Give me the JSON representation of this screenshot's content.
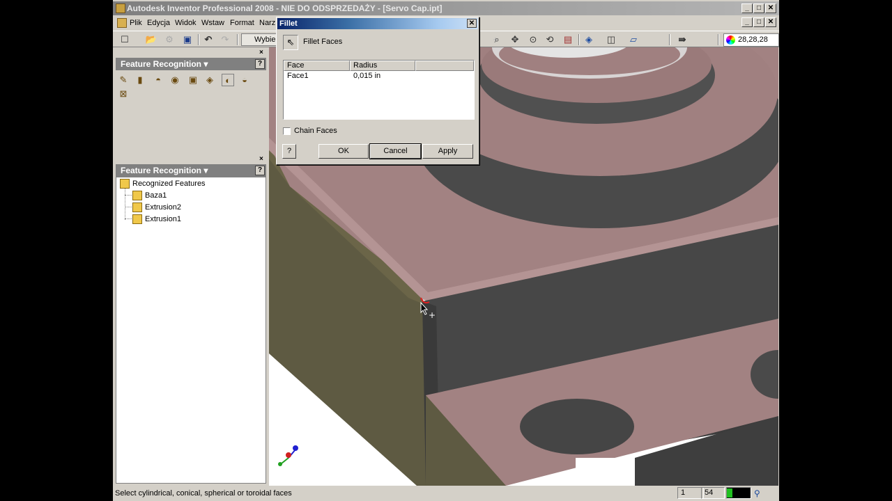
{
  "window": {
    "title": "Autodesk Inventor Professional 2008 - NIE DO ODSPRZEDAŻY - [Servo Cap.ipt]",
    "minimize": "_",
    "maximize": "□",
    "close": "✕"
  },
  "menu": {
    "items": [
      "Plik",
      "Edycja",
      "Widok",
      "Wstaw",
      "Format",
      "Narz"
    ]
  },
  "toolbar": {
    "select_label": "Wybie",
    "color_value": "28,28,28"
  },
  "panel1": {
    "title": "Feature Recognition",
    "help": "?",
    "close": "×"
  },
  "panel2": {
    "title": "Feature Recognition",
    "help": "?",
    "tree": {
      "root": "Recognized Features",
      "children": [
        "Baza1",
        "Extrusion2",
        "Extrusion1"
      ]
    }
  },
  "dialog": {
    "title": "Fillet",
    "close": "✕",
    "mode_label": "Fillet Faces",
    "grid": {
      "headers": [
        "Face",
        "Radius"
      ],
      "rows": [
        {
          "face": "Face1",
          "radius": "0,015 in"
        }
      ]
    },
    "chain_faces_label": "Chain Faces",
    "chain_faces_checked": false,
    "help": "?",
    "ok_label": "OK",
    "cancel_label": "Cancel",
    "apply_label": "Apply"
  },
  "statusbar": {
    "prompt": "Select cylindrical, conical, spherical or toroidal faces",
    "field1": "1",
    "field2": "54"
  },
  "colors": {
    "pink_face": "#a08080",
    "dark_face": "#4a4a4a",
    "olive_face": "#5e5a42",
    "title_active": "#0a246a"
  }
}
